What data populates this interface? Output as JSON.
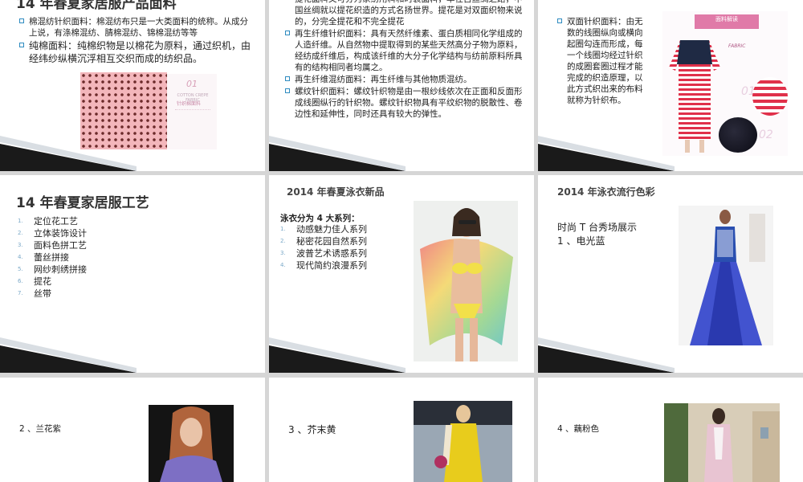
{
  "slide1": {
    "title": "14 年春夏家居服产品面料",
    "bullets": [
      "棉混纺针织面料：棉混纺布只是一大类面料的统称。从成分上说，有涤棉混纺、腈棉混纺、锦棉混纺等等",
      "纯棉面料：纯棉织物是以棉花为原料，通过织机，由经纬纱纵横沉浮相互交织而成的纺织品。"
    ],
    "card": {
      "number": "01",
      "title_en": "COTTON CREPE FABRIC",
      "title_cn": "针织棉面料"
    }
  },
  "slide2": {
    "bullets": [
      "提花面料又可分为家纺用料和时装面料，早在古丝绸之路，中国丝绸就以提花织造的方式名扬世界。提花是对双面织物来说的，分完全提花和不完全提花",
      "再生纤维针织面料：具有天然纤维素、蛋白质相同化学组成的人造纤维。从自然物中提取得到的某些天然高分子物为原料，经纺成纤维后，构成该纤维的大分子化学结构与纺前原料所具有的结构相同者均属之。",
      "再生纤维混纺面料：再生纤维与其他物质混纺。",
      "螺纹针织面料：螺纹针织物是由一根纱线依次在正面和反面形成线圈纵行的针织物。螺纹针织物具有平纹织物的脱散性、卷边性和延伸性，同时还具有较大的弹性。"
    ]
  },
  "slide3": {
    "bullet": "双面针织面料：由无数的线圈纵向或横向起圈勾连而形成，每一个线圈均经过针织的成圈套圈过程才能完成的织造原理，以此方式织出来的布料就称为针织布。",
    "card": {
      "header": "面料解读",
      "brand": "FABRIC",
      "num1": "01",
      "num2": "02"
    }
  },
  "slide4": {
    "title": "14 年春夏家居服工艺",
    "items": [
      "定位花工艺",
      "立体装饰设计",
      "面料色拼工艺",
      "蕾丝拼接",
      "网纱刺绣拼接",
      "提花",
      "丝带"
    ],
    "numbers": [
      "1.",
      "2.",
      "3.",
      "4.",
      "5.",
      "6.",
      "7."
    ]
  },
  "slide5": {
    "title": "2014 年春夏泳衣新品",
    "heading": "泳衣分为 4 大系列：",
    "items": [
      "动感魅力佳人系列",
      "秘密花园自然系列",
      "波普艺术诱惑系列",
      "现代简约浪漫系列"
    ],
    "numbers": [
      "1.",
      "2.",
      "3.",
      "4."
    ]
  },
  "slide6": {
    "title": "2014 年泳衣流行色彩",
    "line1": "时尚 T 台秀场展示",
    "line2": "1 、电光蓝"
  },
  "slide7": {
    "label": "2 、兰花紫"
  },
  "slide8": {
    "label": "3 、芥末黄"
  },
  "slide9": {
    "label": "4 、藕粉色"
  },
  "colors": {
    "accent_blue": "#2e8bc0",
    "stripe_dark": "#1a1a1a",
    "stripe_light": "#d9dee3"
  }
}
